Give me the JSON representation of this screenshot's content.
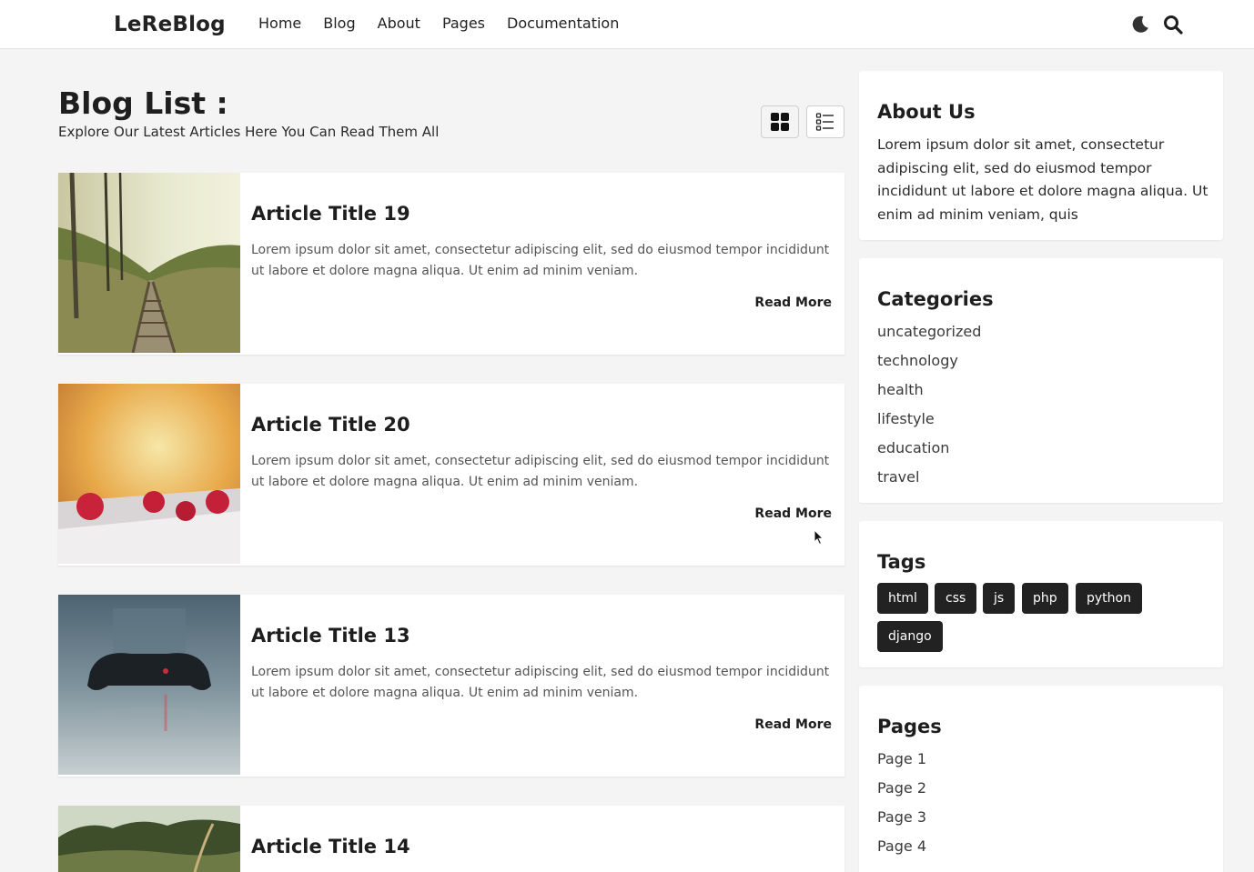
{
  "header": {
    "logo": "LeReBlog",
    "nav": [
      "Home",
      "Blog",
      "About",
      "Pages",
      "Documentation"
    ],
    "icons": [
      "moon-icon",
      "search-icon"
    ]
  },
  "page": {
    "title": "Blog List :",
    "subtitle": "Explore Our Latest Articles Here You Can Read Them All"
  },
  "articles": [
    {
      "title": "Article Title 19",
      "excerpt": "Lorem ipsum dolor sit amet, consectetur adipiscing elit, sed do eiusmod tempor incididunt ut labore et dolore magna aliqua. Ut enim ad minim veniam.",
      "read_more": "Read More"
    },
    {
      "title": "Article Title 20",
      "excerpt": "Lorem ipsum dolor sit amet, consectetur adipiscing elit, sed do eiusmod tempor incididunt ut labore et dolore magna aliqua. Ut enim ad minim veniam.",
      "read_more": "Read More"
    },
    {
      "title": "Article Title 13",
      "excerpt": "Lorem ipsum dolor sit amet, consectetur adipiscing elit, sed do eiusmod tempor incididunt ut labore et dolore magna aliqua. Ut enim ad minim veniam.",
      "read_more": "Read More"
    },
    {
      "title": "Article Title 14",
      "excerpt": "",
      "read_more": ""
    }
  ],
  "sidebar": {
    "about": {
      "title": "About Us",
      "text": "Lorem ipsum dolor sit amet, consectetur adipiscing elit, sed do eiusmod tempor incididunt ut labore et dolore magna aliqua. Ut enim ad minim veniam, quis"
    },
    "categories": {
      "title": "Categories",
      "items": [
        "uncategorized",
        "technology",
        "health",
        "lifestyle",
        "education",
        "travel"
      ]
    },
    "tags": {
      "title": "Tags",
      "items": [
        "html",
        "css",
        "js",
        "php",
        "python",
        "django"
      ]
    },
    "pages": {
      "title": "Pages",
      "items": [
        "Page 1",
        "Page 2",
        "Page 3",
        "Page 4"
      ]
    }
  },
  "colors": {
    "background": "#f4f4f4",
    "card": "#ffffff",
    "text": "#1e1e1e",
    "tag_bg": "#222222"
  }
}
